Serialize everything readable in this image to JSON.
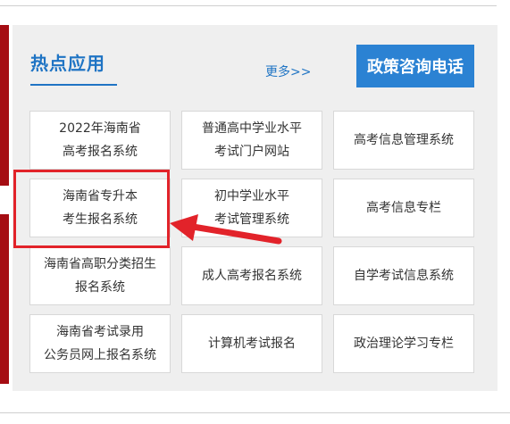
{
  "section": {
    "title": "热点应用",
    "more": "更多>>",
    "hotline": "政策咨询电话"
  },
  "tiles": [
    {
      "line1": "2022年海南省",
      "line2": "高考报名系统"
    },
    {
      "line1": "普通高中学业水平",
      "line2": "考试门户网站"
    },
    {
      "line1": "高考信息管理系统",
      "line2": ""
    },
    {
      "line1": "海南省专升本",
      "line2": "考生报名系统"
    },
    {
      "line1": "初中学业水平",
      "line2": "考试管理系统"
    },
    {
      "line1": "高考信息专栏",
      "line2": ""
    },
    {
      "line1": "海南省高职分类招生",
      "line2": "报名系统"
    },
    {
      "line1": "成人高考报名系统",
      "line2": ""
    },
    {
      "line1": "自学考试信息系统",
      "line2": ""
    },
    {
      "line1": "海南省考试录用",
      "line2": "公务员网上报名系统"
    },
    {
      "line1": "计算机考试报名",
      "line2": ""
    },
    {
      "line1": "政治理论学习专栏",
      "line2": ""
    }
  ],
  "colors": {
    "accent_blue": "#1f74c4",
    "hotline_bg": "#2b82d3",
    "highlight_red": "#e2232a",
    "side_bar": "#a50d13"
  },
  "annotation": {
    "highlighted_tile_index": 3
  }
}
